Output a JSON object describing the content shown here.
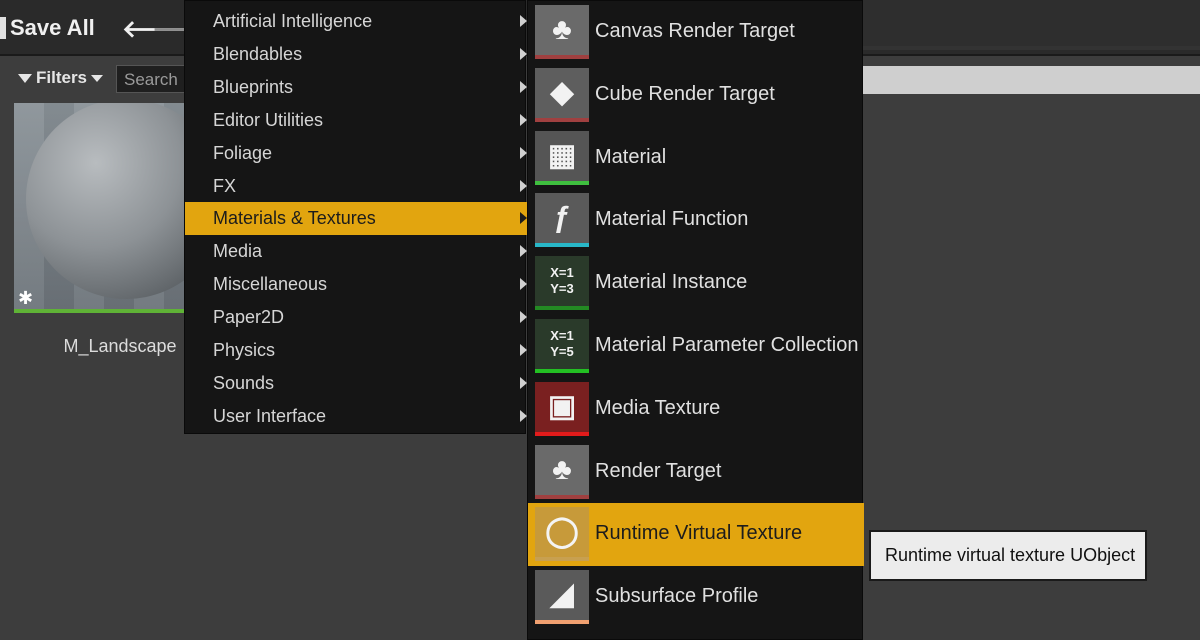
{
  "toolbar": {
    "save_all": "Save All",
    "back_icon": "🡐",
    "forward_icon": "🡒"
  },
  "filters": {
    "label": "Filters",
    "search_placeholder": "Search"
  },
  "asset": {
    "name": "M_Landscape",
    "bar_color": "#5fb336"
  },
  "category_menu": {
    "items": [
      {
        "label": "Artificial Intelligence"
      },
      {
        "label": "Blendables"
      },
      {
        "label": "Blueprints"
      },
      {
        "label": "Editor Utilities"
      },
      {
        "label": "Foliage"
      },
      {
        "label": "FX"
      },
      {
        "label": "Materials & Textures",
        "active": true
      },
      {
        "label": "Media"
      },
      {
        "label": "Miscellaneous"
      },
      {
        "label": "Paper2D"
      },
      {
        "label": "Physics"
      },
      {
        "label": "Sounds"
      },
      {
        "label": "User Interface"
      }
    ]
  },
  "asset_menu": {
    "items": [
      {
        "label": "Canvas Render Target",
        "icon": "tree-render-target-icon",
        "bar": "#a04040"
      },
      {
        "label": "Cube Render Target",
        "icon": "cube-render-target-icon",
        "bar": "#a04040"
      },
      {
        "label": "Material",
        "icon": "material-grid-icon",
        "bar": "#3fbf3f"
      },
      {
        "label": "Material Function",
        "icon": "function-icon",
        "bar": "#28b7c8"
      },
      {
        "label": "Material Instance",
        "icon": "material-instance-icon",
        "bar": "#238a23",
        "glyph": "X=1\nY=3"
      },
      {
        "label": "Material Parameter Collection",
        "icon": "parameter-collection-icon",
        "bar": "#23c023",
        "glyph": "X=1\nY=5"
      },
      {
        "label": "Media Texture",
        "icon": "media-texture-icon",
        "bar": "#e21b1b"
      },
      {
        "label": "Render Target",
        "icon": "render-target-icon",
        "bar": "#a04040"
      },
      {
        "label": "Runtime Virtual Texture",
        "icon": "ring-icon",
        "bar": "#c8a050",
        "active": true
      },
      {
        "label": "Subsurface Profile",
        "icon": "subsurface-profile-icon",
        "bar": "#f0a070"
      }
    ]
  },
  "tooltip": {
    "text": "Runtime virtual texture UObject"
  },
  "colors": {
    "accent": "#e2a50f",
    "menu_bg": "#151515",
    "panel_bg": "#3d3d3d"
  }
}
